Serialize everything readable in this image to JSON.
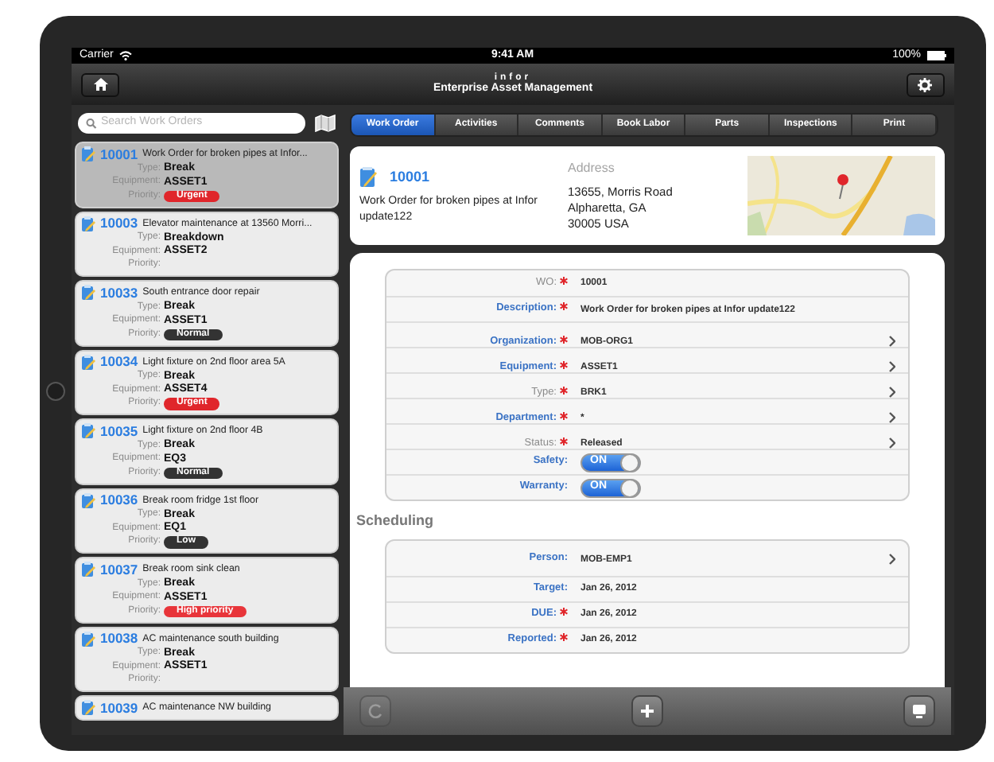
{
  "status_bar": {
    "carrier": "Carrier",
    "time": "9:41 AM",
    "battery": "100%"
  },
  "nav_bar": {
    "logo": "infor",
    "title": "Enterprise Asset Management"
  },
  "search": {
    "placeholder": "Search Work Orders"
  },
  "work_orders": [
    {
      "number": "10001",
      "title": "Work Order for broken pipes at Infor...",
      "type_label": "Type:",
      "type": "Break",
      "equipment_label": "Equipment:",
      "equipment": "ASSET1",
      "priority_label": "Priority:",
      "priority": "Urgent",
      "color": "#e0262b",
      "selected": true
    },
    {
      "number": "10003",
      "title": "Elevator maintenance at 13560 Morri...",
      "type_label": "Type:",
      "type": "Breakdown",
      "equipment_label": "Equipment:",
      "equipment": "ASSET2",
      "priority_label": "Priority:",
      "selected": false
    },
    {
      "number": "10033",
      "title": "South entrance door repair",
      "type_label": "Type:",
      "type": "Break",
      "equipment_label": "Equipment:",
      "equipment": "ASSET1",
      "priority_label": "Priority:",
      "priority": "Normal",
      "color": "#333333",
      "selected": false
    },
    {
      "number": "10034",
      "title": "Light fixture on 2nd floor area 5A",
      "type_label": "Type:",
      "type": "Break",
      "equipment_label": "Equipment:",
      "equipment": "ASSET4",
      "priority_label": "Priority:",
      "priority": "Urgent",
      "color": "#e0262b",
      "selected": false
    },
    {
      "number": "10035",
      "title": "Light fixture on 2nd floor 4B",
      "type_label": "Type:",
      "type": "Break",
      "equipment_label": "Equipment:",
      "equipment": "EQ3",
      "priority_label": "Priority:",
      "priority": "Normal",
      "color": "#333333",
      "selected": false
    },
    {
      "number": "10036",
      "title": "Break room fridge 1st floor",
      "type_label": "Type:",
      "type": "Break",
      "equipment_label": "Equipment:",
      "equipment": "EQ1",
      "priority_label": "Priority:",
      "priority": "Low",
      "color": "#333333",
      "selected": false
    },
    {
      "number": "10037",
      "title": "Break room sink clean",
      "type_label": "Type:",
      "type": "Break",
      "equipment_label": "Equipment:",
      "equipment": "ASSET1",
      "priority_label": "Priority:",
      "priority": "High priority",
      "color": "#e8353a",
      "selected": false
    },
    {
      "number": "10038",
      "title": "AC maintenance south building",
      "type_label": "Type:",
      "type": "Break",
      "equipment_label": "Equipment:",
      "equipment": "ASSET1",
      "priority_label": "Priority:",
      "selected": false
    },
    {
      "number": "10039",
      "title": "AC maintenance NW building",
      "selected": false
    }
  ],
  "tabs": [
    {
      "label": "Work Order",
      "selected": true
    },
    {
      "label": "Activities",
      "selected": false
    },
    {
      "label": "Comments",
      "selected": false
    },
    {
      "label": "Book Labor",
      "selected": false
    },
    {
      "label": "Parts",
      "selected": false
    },
    {
      "label": "Inspections",
      "selected": false
    },
    {
      "label": "Print",
      "selected": false
    }
  ],
  "header": {
    "number": "10001",
    "description": "Work Order for broken pipes at Infor update122",
    "address_label": "Address",
    "address": [
      "13655, Morris Road",
      "Alpharetta, GA",
      "30005 USA"
    ]
  },
  "fields": [
    {
      "kind": "text",
      "label": "WO:",
      "value": "10001",
      "required": true,
      "editable": false,
      "chevron": false
    },
    {
      "kind": "text",
      "label": "Description:",
      "value": "Work Order for broken pipes at Infor update122",
      "required": true,
      "editable": true,
      "chevron": false
    },
    {
      "kind": "text",
      "label": "Organization:",
      "value": "MOB-ORG1",
      "required": true,
      "editable": true,
      "chevron": true
    },
    {
      "kind": "text",
      "label": "Equipment:",
      "value": "ASSET1",
      "required": true,
      "editable": true,
      "chevron": true
    },
    {
      "kind": "text",
      "label": "Type:",
      "value": "BRK1",
      "required": true,
      "editable": false,
      "chevron": true
    },
    {
      "kind": "text",
      "label": "Department:",
      "value": "*",
      "required": true,
      "editable": true,
      "chevron": true
    },
    {
      "kind": "text",
      "label": "Status:",
      "value": "Released",
      "required": true,
      "editable": false,
      "chevron": true
    },
    {
      "kind": "toggle",
      "label": "Safety:",
      "value": "ON",
      "on": true,
      "required": false,
      "editable": true,
      "chevron": false
    },
    {
      "kind": "toggle",
      "label": "Warranty:",
      "value": "ON",
      "on": true,
      "required": false,
      "editable": true,
      "chevron": false
    }
  ],
  "scheduling": {
    "title": "Scheduling",
    "fields": [
      {
        "kind": "text",
        "label": "Person:",
        "value": "MOB-EMP1",
        "required": false,
        "editable": true,
        "chevron": true
      },
      {
        "kind": "text",
        "label": "Target:",
        "value": "Jan 26, 2012",
        "required": false,
        "editable": true,
        "chevron": false
      },
      {
        "kind": "text",
        "label": "DUE:",
        "value": "Jan 26, 2012",
        "required": true,
        "editable": true,
        "chevron": false
      },
      {
        "kind": "text",
        "label": "Reported:",
        "value": "Jan 26, 2012",
        "required": true,
        "editable": true,
        "chevron": false
      }
    ]
  },
  "toolbar": [
    {
      "kind": "refresh",
      "disabled": true
    },
    {
      "kind": "add",
      "disabled": false
    },
    {
      "kind": "monitor",
      "disabled": false
    }
  ]
}
